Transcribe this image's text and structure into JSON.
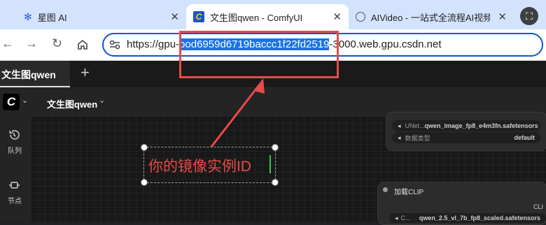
{
  "browser": {
    "tabs": [
      {
        "title": "星图 AI",
        "active": false
      },
      {
        "title": "文生图qwen - ComfyUI",
        "active": true
      },
      {
        "title": "AIVideo - 一站式全流程AI视频",
        "active": false
      }
    ],
    "url": {
      "prefix": "https://gpu-",
      "selected": "pod6959d6719baccc1f22fd2519",
      "suffix": "-3000.web.gpu.csdn.net"
    }
  },
  "app": {
    "tab_title": "文生图qwen",
    "workflow_name": "文生图qwen",
    "sidebar": [
      {
        "label": "队列",
        "icon": "history-icon"
      },
      {
        "label": "节点",
        "icon": "node-icon"
      }
    ]
  },
  "nodes": {
    "unet": {
      "name_label": "UNet...",
      "name_value": "qwen_image_fp8_e4m3fn.safetensors",
      "dtype_label": "数据类型",
      "dtype_value": "default"
    },
    "clip": {
      "title": "加载CLIP",
      "partial_label": "CLI",
      "widget_label": "C...",
      "widget_value": "qwen_2.5_vl_7b_fp8_scaled.safetensors"
    }
  },
  "annotation": {
    "text": "你的镜像实例ID",
    "color": "#e84a4a"
  }
}
